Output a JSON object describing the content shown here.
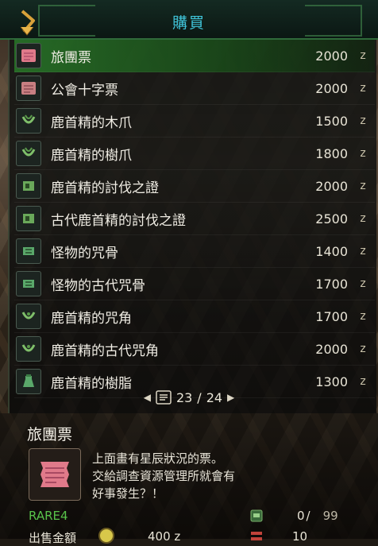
{
  "header": {
    "title": "購買"
  },
  "items": [
    {
      "name": "旅團票",
      "price": "2000",
      "unit": "z",
      "icon": "ticket-icon"
    },
    {
      "name": "公會十字票",
      "price": "2000",
      "unit": "z",
      "icon": "ticket-icon"
    },
    {
      "name": "鹿首精的木爪",
      "price": "1500",
      "unit": "z",
      "icon": "claw-icon"
    },
    {
      "name": "鹿首精的樹爪",
      "price": "1800",
      "unit": "z",
      "icon": "claw-icon"
    },
    {
      "name": "鹿首精的討伐之證",
      "price": "2000",
      "unit": "z",
      "icon": "proof-icon"
    },
    {
      "name": "古代鹿首精的討伐之證",
      "price": "2500",
      "unit": "z",
      "icon": "proof-icon"
    },
    {
      "name": "怪物的咒骨",
      "price": "1400",
      "unit": "z",
      "icon": "bone-icon"
    },
    {
      "name": "怪物的古代咒骨",
      "price": "1700",
      "unit": "z",
      "icon": "bone-icon"
    },
    {
      "name": "鹿首精的咒角",
      "price": "1700",
      "unit": "z",
      "icon": "horn-icon"
    },
    {
      "name": "鹿首精的古代咒角",
      "price": "2000",
      "unit": "z",
      "icon": "horn-icon"
    },
    {
      "name": "鹿首精的樹脂",
      "price": "1300",
      "unit": "z",
      "icon": "resin-icon"
    }
  ],
  "pager": {
    "current": "23",
    "total": "24"
  },
  "detail": {
    "name": "旅團票",
    "desc": [
      "上面畫有星辰狀況的票。",
      "交給調查資源管理所就會有",
      "好事發生？！"
    ],
    "rarity": "RARE4",
    "owned": "0",
    "owned_sep": "/",
    "max": "99",
    "sell_label": "出售金額",
    "sell_value": "400 z",
    "quantity": "10"
  },
  "colors": {
    "accent": "#3fc3d8",
    "selected": "#2a7a2a",
    "rare": "#58c24a"
  }
}
